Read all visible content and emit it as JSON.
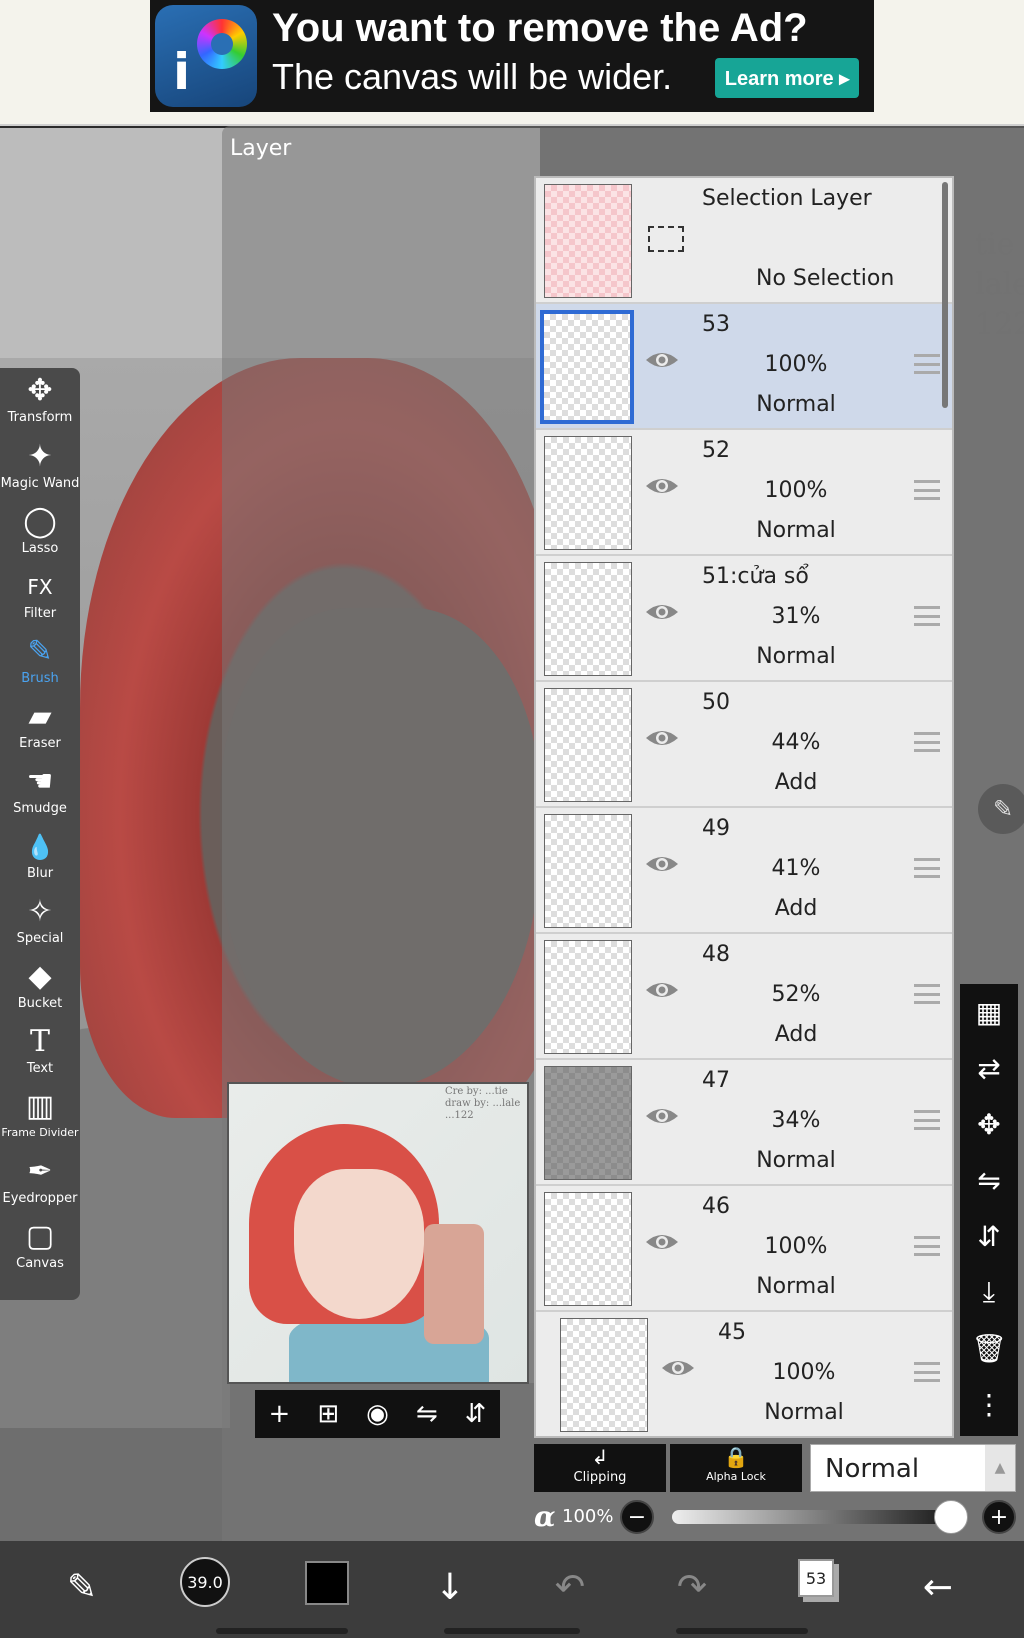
{
  "ad": {
    "title": "You want to remove the Ad?",
    "subtitle": "The canvas will be wider.",
    "learn_more": "Learn more ▸",
    "logo_letter": "i"
  },
  "panel": {
    "title": "Layer"
  },
  "tools": [
    {
      "label": "Transform",
      "icon": "✥"
    },
    {
      "label": "Magic Wand",
      "icon": "✦"
    },
    {
      "label": "Lasso",
      "icon": "◯"
    },
    {
      "label": "Filter",
      "icon": "FX"
    },
    {
      "label": "Brush",
      "icon": "✎"
    },
    {
      "label": "Eraser",
      "icon": "▰"
    },
    {
      "label": "Smudge",
      "icon": "☚"
    },
    {
      "label": "Blur",
      "icon": "💧"
    },
    {
      "label": "Special",
      "icon": "✧"
    },
    {
      "label": "Bucket",
      "icon": "◆"
    },
    {
      "label": "Text",
      "icon": "T"
    },
    {
      "label": "Frame Divider",
      "icon": "▥"
    },
    {
      "label": "Eyedropper",
      "icon": "✒"
    },
    {
      "label": "Canvas",
      "icon": "▢"
    }
  ],
  "selection_layer": {
    "name": "Selection Layer",
    "status": "No Selection"
  },
  "layers": [
    {
      "name": "53",
      "opacity": "100%",
      "mode": "Normal",
      "selected": true
    },
    {
      "name": "52",
      "opacity": "100%",
      "mode": "Normal"
    },
    {
      "name": "51:cửa sổ",
      "opacity": "31%",
      "mode": "Normal"
    },
    {
      "name": "50",
      "opacity": "44%",
      "mode": "Add"
    },
    {
      "name": "49",
      "opacity": "41%",
      "mode": "Add"
    },
    {
      "name": "48",
      "opacity": "52%",
      "mode": "Add"
    },
    {
      "name": "47",
      "opacity": "34%",
      "mode": "Normal"
    },
    {
      "name": "46",
      "opacity": "100%",
      "mode": "Normal"
    },
    {
      "name": "45",
      "opacity": "100%",
      "mode": "Normal"
    }
  ],
  "layer_controls": {
    "clipping": "Clipping",
    "alpha_lock": "Alpha Lock",
    "blend_mode": "Normal",
    "alpha_symbol": "α",
    "opacity": "100%",
    "opacity_value": 1.0
  },
  "bottom": {
    "brush_size": "39.0",
    "color": "#000000",
    "layer_count": "53"
  }
}
